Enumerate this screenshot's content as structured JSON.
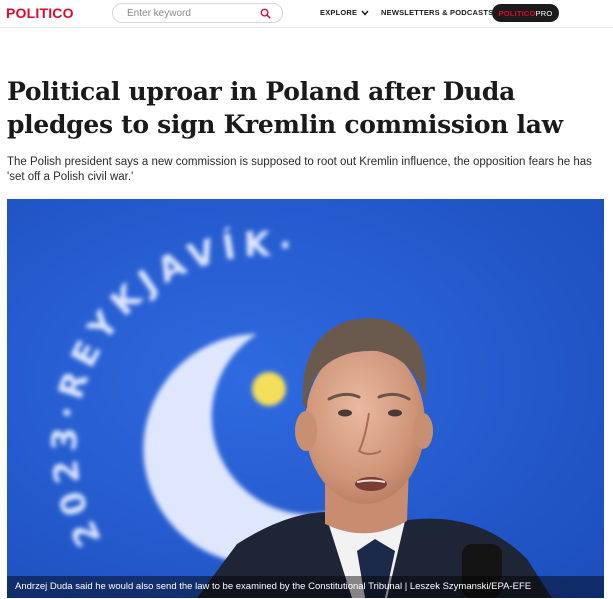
{
  "header": {
    "logo": "POLITICO",
    "search_placeholder": "Enter keyword",
    "nav": [
      {
        "label": "EXPLORE"
      },
      {
        "label": "NEWSLETTERS & PODCASTS"
      }
    ],
    "pro_button": {
      "part1": "POLITICO",
      "part2": "PRO"
    }
  },
  "article": {
    "headline": "Political uproar in Poland after Duda pledges to sign Kremlin commission law",
    "dek": "The Polish president says a new commission is supposed to root out Kremlin influence, the opposition fears he has 'set off a Polish civil war.'",
    "image": {
      "backdrop_text": "2023·REYKJAVÍK·",
      "caption": "Andrzej Duda said he would also send the law to be examined by the Constitutional Tribunal | Leszek Szymanski/EPA-EFE"
    }
  },
  "colors": {
    "brand_red": "#dc0a2d",
    "pro_button_bg": "#1b1b1b",
    "photo_backdrop": "#2358cf"
  },
  "icons": {
    "search": "search-icon",
    "chevron": "chevron-down-icon"
  }
}
